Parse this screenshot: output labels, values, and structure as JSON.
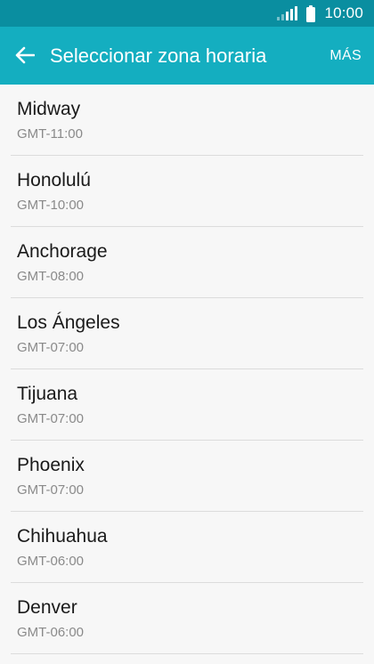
{
  "status_bar": {
    "time": "10:00",
    "icons": [
      "signal-icon",
      "battery-icon"
    ]
  },
  "app_bar": {
    "back_icon": "arrow-left-icon",
    "title": "Seleccionar zona horaria",
    "more_label": "MÁS"
  },
  "colors": {
    "status_bar": "#0a8ea0",
    "app_bar": "#14aec0",
    "background": "#f7f7f7",
    "divider": "#dcdcdc"
  },
  "timezones": [
    {
      "name": "Midway",
      "offset": "GMT-11:00"
    },
    {
      "name": "Honolulú",
      "offset": "GMT-10:00"
    },
    {
      "name": "Anchorage",
      "offset": "GMT-08:00"
    },
    {
      "name": "Los Ángeles",
      "offset": "GMT-07:00"
    },
    {
      "name": "Tijuana",
      "offset": "GMT-07:00"
    },
    {
      "name": "Phoenix",
      "offset": "GMT-07:00"
    },
    {
      "name": "Chihuahua",
      "offset": "GMT-06:00"
    },
    {
      "name": "Denver",
      "offset": "GMT-06:00"
    }
  ]
}
